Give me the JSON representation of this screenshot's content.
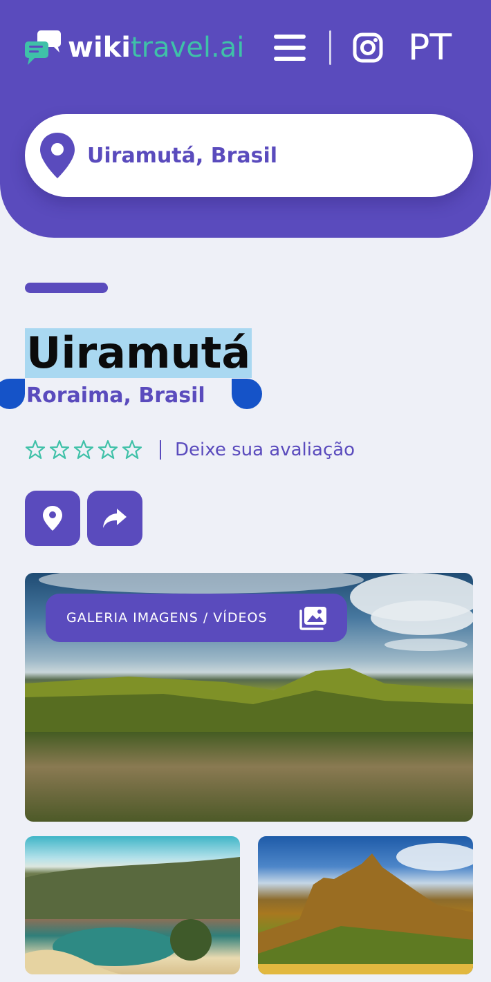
{
  "header": {
    "logo": {
      "part1": "wiki",
      "part2": "travel.ai"
    },
    "menu_icon": "hamburger-menu-icon",
    "social_icon": "instagram-icon",
    "language": "PT"
  },
  "search": {
    "value": "Uiramutá, Brasil",
    "icon": "location-pin-icon"
  },
  "place": {
    "title": "Uiramutá",
    "subtitle": "Roraima, Brasil",
    "rating": {
      "stars": 0,
      "max": 5,
      "cta": "Deixe sua avaliação"
    }
  },
  "actions": [
    {
      "name": "map-location",
      "icon": "location-pin-icon"
    },
    {
      "name": "share",
      "icon": "share-arrow-icon"
    }
  ],
  "gallery": {
    "label": "GALERIA IMAGENS / VÍDEOS",
    "icon": "image-gallery-icon"
  },
  "colors": {
    "brand": "#5a4bbd",
    "accent": "#3fc1a8",
    "background": "#eef0f7",
    "selection": "#a9d8f1",
    "selection_handle": "#1553c8"
  }
}
